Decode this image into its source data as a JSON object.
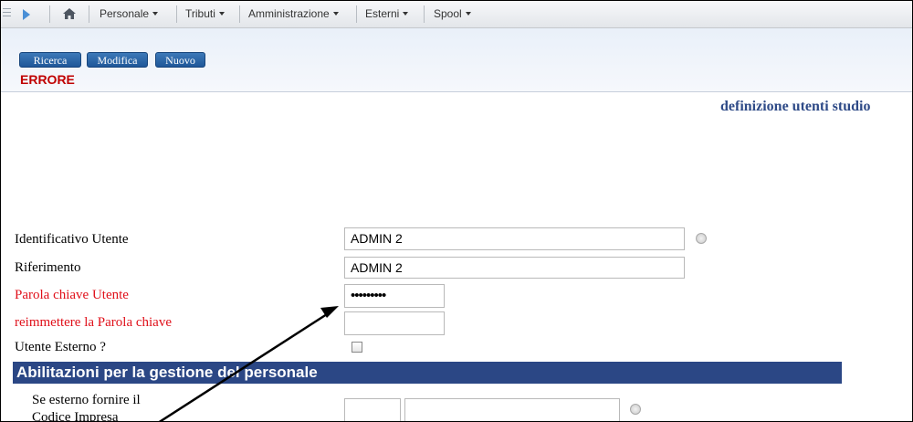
{
  "nav": {
    "menus": [
      {
        "label": "Personale"
      },
      {
        "label": "Tributi"
      },
      {
        "label": "Amministrazione"
      },
      {
        "label": "Esterni"
      },
      {
        "label": "Spool"
      }
    ]
  },
  "toolbar": {
    "ricerca_label": "Ricerca",
    "modifica_label": "Modifica",
    "nuovo_label": "Nuovo",
    "error_text": "ERRORE"
  },
  "page": {
    "title": "definizione utenti studio"
  },
  "form": {
    "identificativo_label": "Identificativo Utente",
    "identificativo_value": "ADMIN 2",
    "riferimento_label": "Riferimento",
    "riferimento_value": "ADMIN 2",
    "password_label": "Parola chiave Utente",
    "password_value": "•••••••••",
    "repeat_password_label": "reimmettere la Parola chiave",
    "repeat_password_value": "",
    "esterno_label": "Utente Esterno ?"
  },
  "section": {
    "title": "Abilitazioni per la gestione del personale",
    "codice_label_line1": "Se esterno fornire il",
    "codice_label_line2": "Codice Impresa"
  },
  "colors": {
    "nav_accent": "#4a8fd6",
    "button": "#1f5799",
    "error": "#c00000",
    "title": "#2e4a87",
    "required_label": "#e0101a",
    "section_header": "#2b4785"
  }
}
